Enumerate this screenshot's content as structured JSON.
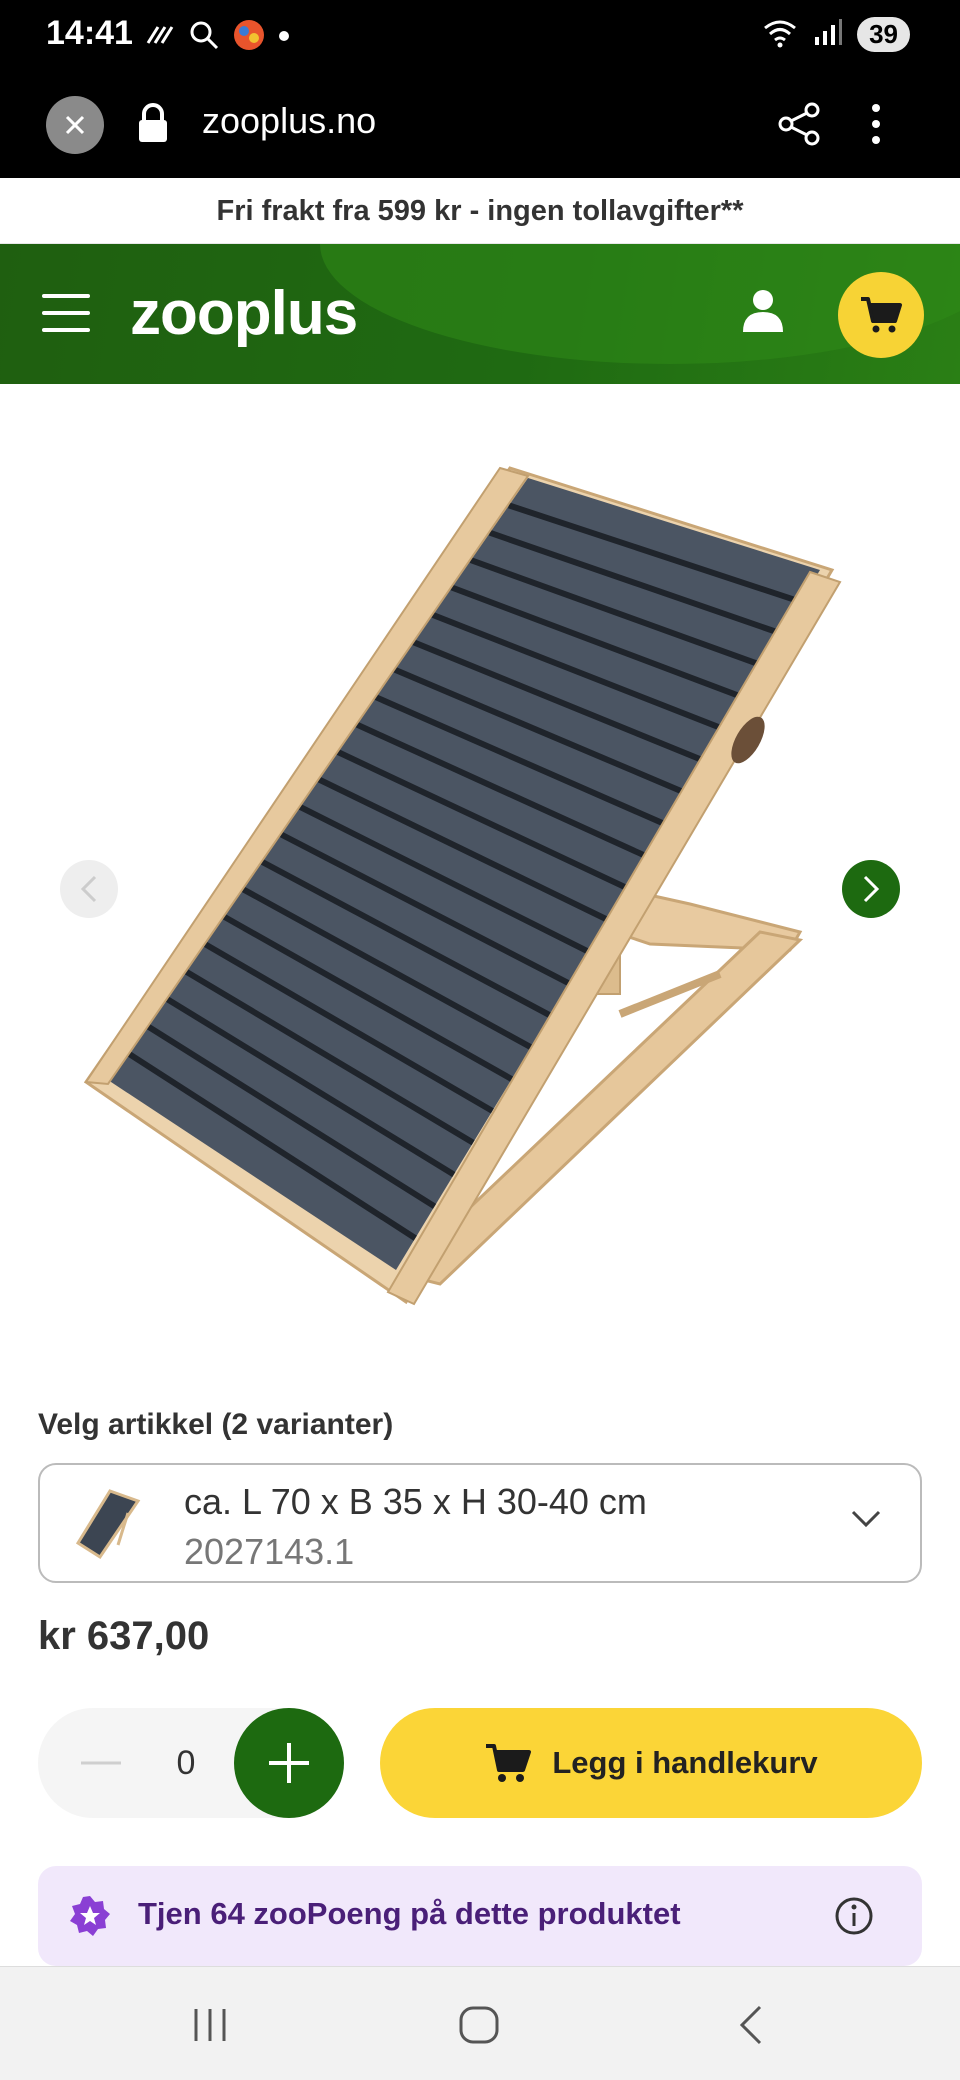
{
  "status_bar": {
    "time": "14:41",
    "battery": "39"
  },
  "browser": {
    "url": "zooplus.no"
  },
  "promo": {
    "text": "Fri frakt fra 599 kr - ingen tollavgifter**"
  },
  "header": {
    "logo": "zooplus"
  },
  "product": {
    "variant_label": "Velg artikkel (2 varianter)",
    "variant_size": "ca. L 70 x B 35 x H 30-40 cm",
    "variant_code": "2027143.1",
    "price": "kr 637,00",
    "quantity": "0",
    "add_to_cart": "Legg i handlekurv",
    "points_text": "Tjen 64 zooPoeng på dette produktet"
  },
  "colors": {
    "brand_green": "#1d6a10",
    "accent_yellow": "#fbd537",
    "points_bg": "#f1e8fb"
  }
}
